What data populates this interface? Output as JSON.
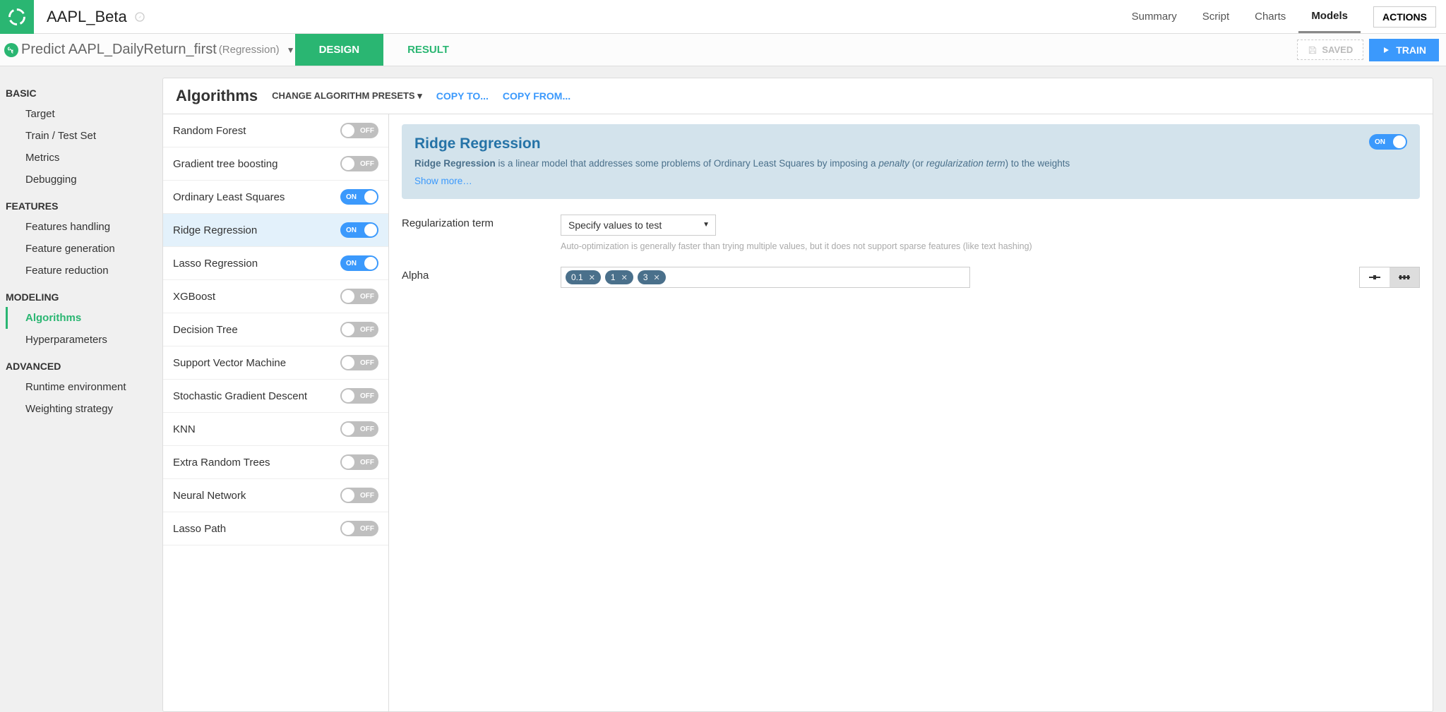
{
  "header": {
    "project": "AAPL_Beta",
    "tabs": [
      "Summary",
      "Script",
      "Charts",
      "Models"
    ],
    "active_tab": "Models",
    "actions": "ACTIONS"
  },
  "subheader": {
    "flow_prefix": "Predict AAPL_DailyReturn_first",
    "flow_type": "(Regression)",
    "tabs": {
      "design": "DESIGN",
      "result": "RESULT"
    },
    "saved": "SAVED",
    "train": "TRAIN"
  },
  "sidebar": {
    "sections": [
      {
        "title": "BASIC",
        "items": [
          "Target",
          "Train / Test Set",
          "Metrics",
          "Debugging"
        ]
      },
      {
        "title": "FEATURES",
        "items": [
          "Features handling",
          "Feature generation",
          "Feature reduction"
        ]
      },
      {
        "title": "MODELING",
        "items": [
          "Algorithms",
          "Hyperparameters"
        ],
        "active": "Algorithms"
      },
      {
        "title": "ADVANCED",
        "items": [
          "Runtime environment",
          "Weighting strategy"
        ]
      }
    ]
  },
  "content": {
    "title": "Algorithms",
    "preset": "CHANGE ALGORITHM PRESETS",
    "copy_to": "COPY TO...",
    "copy_from": "COPY FROM..."
  },
  "algorithms": [
    {
      "name": "Random Forest",
      "on": false
    },
    {
      "name": "Gradient tree boosting",
      "on": false
    },
    {
      "name": "Ordinary Least Squares",
      "on": true
    },
    {
      "name": "Ridge Regression",
      "on": true,
      "selected": true
    },
    {
      "name": "Lasso Regression",
      "on": true
    },
    {
      "name": "XGBoost",
      "on": false
    },
    {
      "name": "Decision Tree",
      "on": false
    },
    {
      "name": "Support Vector Machine",
      "on": false
    },
    {
      "name": "Stochastic Gradient Descent",
      "on": false
    },
    {
      "name": "KNN",
      "on": false
    },
    {
      "name": "Extra Random Trees",
      "on": false
    },
    {
      "name": "Neural Network",
      "on": false
    },
    {
      "name": "Lasso Path",
      "on": false
    }
  ],
  "detail": {
    "title": "Ridge Regression",
    "desc_bold": "Ridge Regression",
    "desc_1": " is a linear model that addresses some problems of Ordinary Least Squares by imposing a ",
    "desc_em1": "penalty",
    "desc_2": " (or ",
    "desc_em2": "regularization term",
    "desc_3": ") to the weights",
    "show_more": "Show more…",
    "reg_label": "Regularization term",
    "reg_value": "Specify values to test",
    "reg_hint": "Auto-optimization is generally faster than trying multiple values, but it does not support sparse features (like text hashing)",
    "alpha_label": "Alpha",
    "alpha_values": [
      "0.1",
      "1",
      "3"
    ]
  },
  "toggle_labels": {
    "on": "ON",
    "off": "OFF"
  }
}
